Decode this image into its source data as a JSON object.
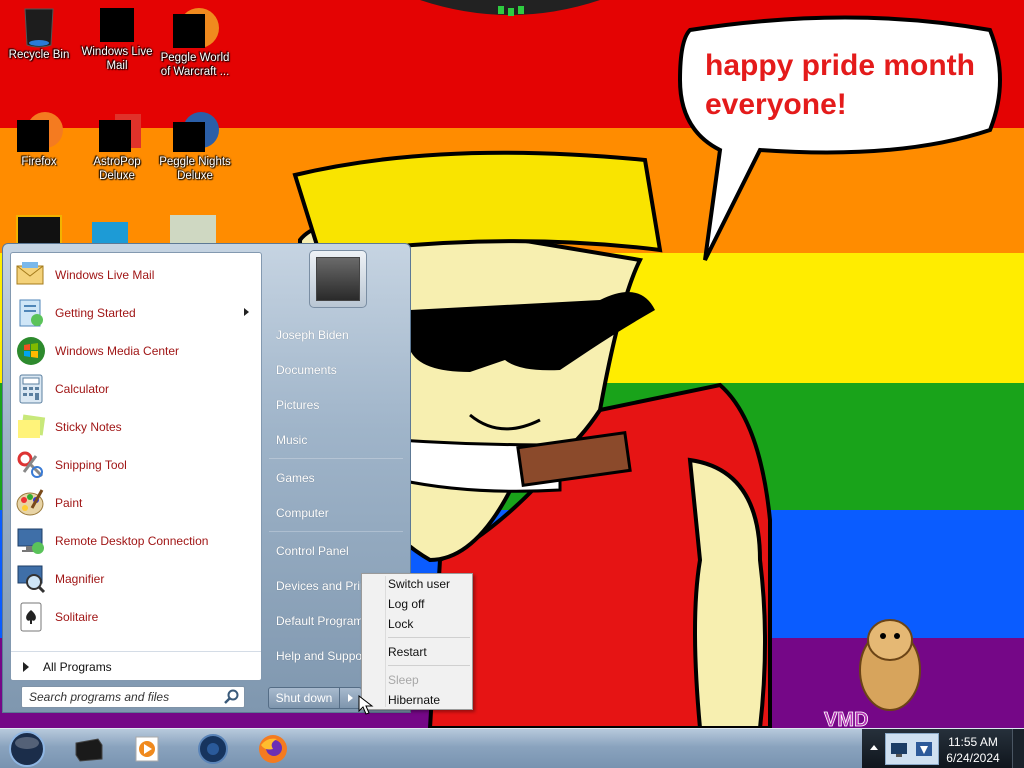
{
  "desktop": {
    "speech_bubble_text": [
      "happy pride month",
      "everyone!"
    ],
    "icons": [
      {
        "label": "Recycle Bin",
        "icon": "recycle-bin-icon"
      },
      {
        "label": "Windows Live Mail",
        "icon": "windows-live-mail-icon"
      },
      {
        "label": "Peggle World of Warcraft ...",
        "icon": "peggle-wow-icon"
      },
      {
        "label": "Firefox",
        "icon": "firefox-icon"
      },
      {
        "label": "AstroPop Deluxe",
        "icon": "astropop-icon"
      },
      {
        "label": "Peggle Nights Deluxe",
        "icon": "peggle-nights-icon"
      }
    ],
    "logo_text": "VMD",
    "colors": {
      "stripe_red": "#e40303",
      "stripe_orange": "#ff8c00",
      "stripe_yellow": "#ffed00",
      "stripe_green": "#19a31a",
      "stripe_blue": "#0a5cff",
      "stripe_purple": "#750787"
    }
  },
  "start_menu": {
    "programs": [
      {
        "label": "Windows Live Mail",
        "icon": "mail-icon",
        "submenu": false
      },
      {
        "label": "Getting Started",
        "icon": "getting-started-icon",
        "submenu": true
      },
      {
        "label": "Windows Media Center",
        "icon": "media-center-icon",
        "submenu": false
      },
      {
        "label": "Calculator",
        "icon": "calculator-icon",
        "submenu": false
      },
      {
        "label": "Sticky Notes",
        "icon": "sticky-notes-icon",
        "submenu": false
      },
      {
        "label": "Snipping Tool",
        "icon": "snipping-tool-icon",
        "submenu": false
      },
      {
        "label": "Paint",
        "icon": "paint-icon",
        "submenu": false
      },
      {
        "label": "Remote Desktop Connection",
        "icon": "remote-desktop-icon",
        "submenu": false
      },
      {
        "label": "Magnifier",
        "icon": "magnifier-icon",
        "submenu": false
      },
      {
        "label": "Solitaire",
        "icon": "solitaire-icon",
        "submenu": false
      }
    ],
    "all_programs": "All Programs",
    "search_placeholder": "Search programs and files",
    "right_items": [
      "Joseph Biden",
      "Documents",
      "Pictures",
      "Music",
      "Games",
      "Computer",
      "Control Panel",
      "Devices and Printers",
      "Default Programs",
      "Help and Support"
    ],
    "shutdown_label": "Shut down"
  },
  "shutdown_menu": {
    "items": [
      {
        "label": "Switch user",
        "enabled": true
      },
      {
        "label": "Log off",
        "enabled": true
      },
      {
        "label": "Lock",
        "enabled": true
      },
      {
        "label": "Restart",
        "enabled": true
      },
      {
        "label": "Sleep",
        "enabled": false
      },
      {
        "label": "Hibernate",
        "enabled": true
      }
    ]
  },
  "taskbar": {
    "pinned": [
      "media-box-icon",
      "media-player-icon",
      "media-center-orb-icon",
      "firefox-icon"
    ],
    "clock_time": "11:55 AM",
    "clock_date": "6/24/2024"
  }
}
